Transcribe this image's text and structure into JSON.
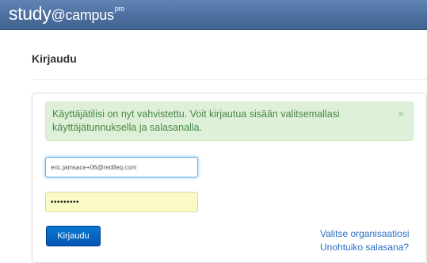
{
  "header": {
    "logo_main": "study",
    "logo_at": "@campus",
    "logo_sup": "pro"
  },
  "page": {
    "title": "Kirjaudu"
  },
  "alert": {
    "message": "Käyttäjätilisi on nyt vahvistettu. Voit kirjautua sisään valitsemallasi käyttäjätunnuksella ja salasanalla.",
    "close_symbol": "×"
  },
  "form": {
    "email_value": "eric.jamsace+06@redifeq.com",
    "password_value": "•••••••••",
    "submit_label": "Kirjaudu"
  },
  "links": {
    "choose_org": "Valitse organisaatiosi",
    "forgot_password": "Unohtuiko salasana?"
  },
  "colors": {
    "header_bg": "#4c6f9f",
    "alert_bg": "#dff0d8",
    "alert_text": "#468847",
    "button_bg": "#0555b3",
    "link": "#2a6fc4",
    "password_bg": "#fafbc4"
  }
}
